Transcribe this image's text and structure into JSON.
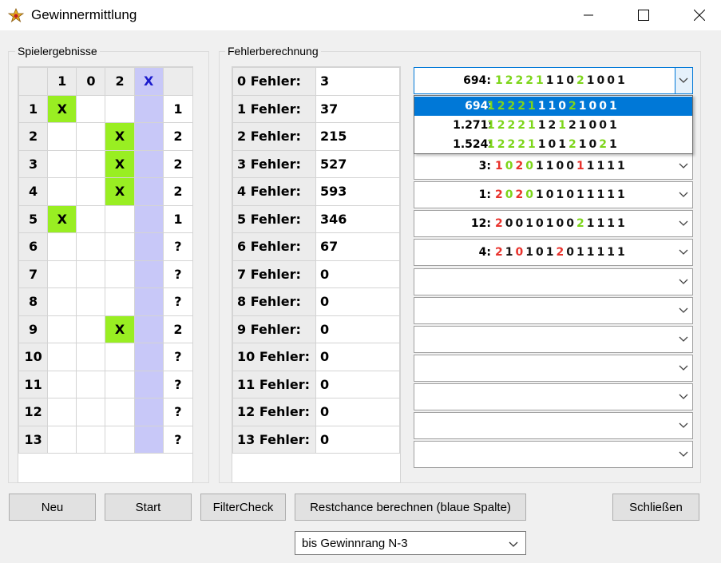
{
  "window": {
    "title": "Gewinnermittlung"
  },
  "left_group": {
    "title": "Spielergebnisse",
    "header": [
      "",
      "1",
      "0",
      "2",
      "X",
      ""
    ],
    "rows": [
      {
        "n": "1",
        "c1": "X",
        "c0": "",
        "c2": "",
        "r": "1",
        "q": false
      },
      {
        "n": "2",
        "c1": "",
        "c0": "",
        "c2": "X",
        "r": "2",
        "q": false
      },
      {
        "n": "3",
        "c1": "",
        "c0": "",
        "c2": "X",
        "r": "2",
        "q": false
      },
      {
        "n": "4",
        "c1": "",
        "c0": "",
        "c2": "X",
        "r": "2",
        "q": false
      },
      {
        "n": "5",
        "c1": "X",
        "c0": "",
        "c2": "",
        "r": "1",
        "q": false
      },
      {
        "n": "6",
        "c1": "",
        "c0": "",
        "c2": "",
        "r": "?",
        "q": true
      },
      {
        "n": "7",
        "c1": "",
        "c0": "",
        "c2": "",
        "r": "?",
        "q": true
      },
      {
        "n": "8",
        "c1": "",
        "c0": "",
        "c2": "",
        "r": "?",
        "q": true
      },
      {
        "n": "9",
        "c1": "",
        "c0": "",
        "c2": "X",
        "r": "2",
        "q": false
      },
      {
        "n": "10",
        "c1": "",
        "c0": "",
        "c2": "",
        "r": "?",
        "q": true
      },
      {
        "n": "11",
        "c1": "",
        "c0": "",
        "c2": "",
        "r": "?",
        "q": true
      },
      {
        "n": "12",
        "c1": "",
        "c0": "",
        "c2": "",
        "r": "?",
        "q": true
      },
      {
        "n": "13",
        "c1": "",
        "c0": "",
        "c2": "",
        "r": "?",
        "q": true
      }
    ]
  },
  "fehler_group": {
    "title": "Fehlerberechnung",
    "rows": [
      {
        "label": "0 Fehler:",
        "value": "3"
      },
      {
        "label": "1 Fehler:",
        "value": "37"
      },
      {
        "label": "2 Fehler:",
        "value": "215"
      },
      {
        "label": "3 Fehler:",
        "value": "527"
      },
      {
        "label": "4 Fehler:",
        "value": "593"
      },
      {
        "label": "5 Fehler:",
        "value": "346"
      },
      {
        "label": "6 Fehler:",
        "value": "67"
      },
      {
        "label": "7 Fehler:",
        "value": "0"
      },
      {
        "label": "8 Fehler:",
        "value": "0"
      },
      {
        "label": "9 Fehler:",
        "value": "0"
      },
      {
        "label": "10 Fehler:",
        "value": "0"
      },
      {
        "label": "11 Fehler:",
        "value": "0"
      },
      {
        "label": "12 Fehler:",
        "value": "0"
      },
      {
        "label": "13 Fehler:",
        "value": "0"
      }
    ]
  },
  "combos": [
    {
      "num": "694:",
      "digits": "1222111021001",
      "colors": "gggggbbbgbbbb"
    },
    {
      "num": "",
      "digits": "",
      "colors": ""
    },
    {
      "num": "3:",
      "digits": "1020110011111",
      "colors": "rgrgbbbbrbbbb"
    },
    {
      "num": "1:",
      "digits": "2020101011111",
      "colors": "rgrgbbbbbbbbb"
    },
    {
      "num": "12:",
      "digits": "2001010021111",
      "colors": "rbbbbbbbgbbbb"
    },
    {
      "num": "4:",
      "digits": "2101012011111",
      "colors": "rbrbbbrbbbbbb"
    },
    {
      "num": "",
      "digits": "",
      "colors": ""
    },
    {
      "num": "",
      "digits": "",
      "colors": ""
    },
    {
      "num": "",
      "digits": "",
      "colors": ""
    },
    {
      "num": "",
      "digits": "",
      "colors": ""
    },
    {
      "num": "",
      "digits": "",
      "colors": ""
    },
    {
      "num": "",
      "digits": "",
      "colors": ""
    },
    {
      "num": "",
      "digits": "",
      "colors": ""
    }
  ],
  "dropdown_items": [
    {
      "num": "694:",
      "digits": "1222111021001",
      "colors": "gggggbbbgbbbb",
      "selected": true
    },
    {
      "num": "1.271:",
      "digits": "1222112121001",
      "colors": "gggggbbgbbbbb",
      "selected": false
    },
    {
      "num": "1.524:",
      "digits": "1222110121021",
      "colors": "gggggbbbgbbgb",
      "selected": false
    }
  ],
  "buttons": {
    "neu": "Neu",
    "start": "Start",
    "filtercheck": "FilterCheck",
    "restchance": "Restchance berechnen (blaue Spalte)",
    "schliessen": "Schließen"
  },
  "rank_select": {
    "value": "bis Gewinnrang N-3"
  }
}
